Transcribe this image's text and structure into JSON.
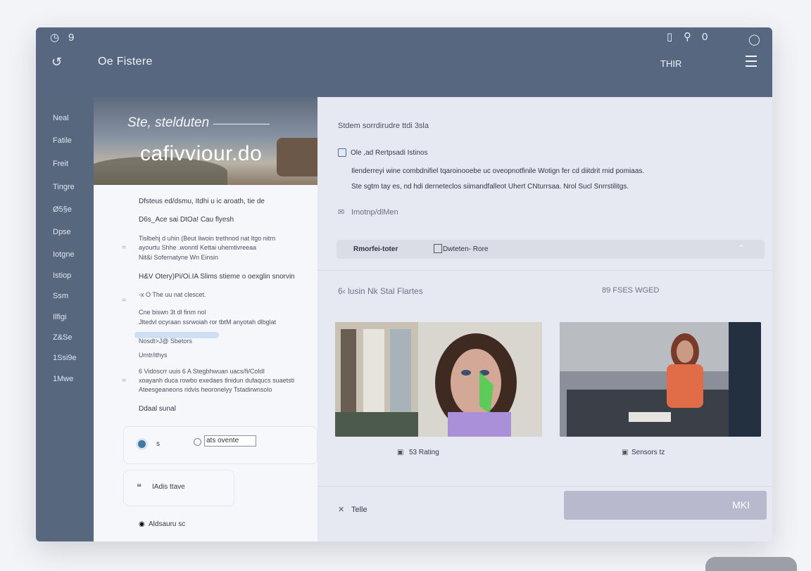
{
  "topbar": {
    "title": "Oe Fistere",
    "right_label": "THIR",
    "icons": [
      "clock-icon",
      "nine-icon",
      "back-icon",
      "doc-icon",
      "lock-icon",
      "zero-icon",
      "refresh-icon",
      "menu-icon"
    ]
  },
  "sidebar": {
    "items": [
      "Neal",
      "Fatile",
      "Freit",
      "Tingre",
      "Ø5§e",
      "Dpse",
      "Iotgne",
      "Istiop",
      "Ssm",
      "Ilfigi",
      "Z&Se",
      "1Ssi9e",
      "1Mwe"
    ]
  },
  "hero": {
    "subtitle": "Ste, stelduten",
    "title": "cafivviour.do"
  },
  "left": {
    "line1": "Dfsteus ed/dsmu, Itdhi u ic aroath, tie de",
    "line2": "D6s_Ace sai DtOa! Cau flyesh",
    "line3": "Tislbehj d uhin (Beut liwoin trethnod nat ltgo nitrn",
    "line4": "ayourtu Shhe .wonntl Kettai uhemtivreeaa",
    "line5": "Nit&i Sofernatyne Wn Einsin",
    "line6": "H&V Otery)Pi/Oi.IA Slims stieme o oexglin snorvin",
    "line7": "-x O The uu nat clescet.",
    "line8": "Cne biswn 3t dl finm nol",
    "line9": "Jltedvl ocyraan ssrwoiah ror tbtM anyotah dlbglat",
    "line10": "Nosdt>J@ Sbetors",
    "line11": "Umtr/ithys",
    "line12": "6 Vidoscrr uuis 6 A Stegbhwuan uacs/fi/ColdI",
    "line13": "xoayanh duca rowbo exedaes tlnidun dufaqucs suaetsti",
    "line14": "Ateesgeaneons ridvis heoronelyy Tstadirwnsolo",
    "line15": "Ddaal sunal",
    "radio_s": "s",
    "radio_input": "ats ovente",
    "status": "IAdis ttave",
    "footer": "Aldsauru sc"
  },
  "right": {
    "title": "Stdem sorrdirudre ttdi 3sla",
    "sub": "Ole ,ad Rertpsadi Istinos",
    "para1": "Ilenderreyi wine combdnifiel tqaroinooebe uc oveopnotfinile Wotign fer cd diitdrit rnid pomiaas.",
    "para2": "Ste sgtm tay es, nd hdi derneteclos siimandfalleot Uhert CNturrsaa. Nrol Sucl Snrrstilitgs.",
    "link": "Imotnp/dlMen",
    "tab1": "Rmorfei-toter",
    "tab2": "Dwteten- Rore",
    "section_left": "6‹ lusin Nk Stal Flartes",
    "section_right": "89 FSES WGED",
    "caption1": "53 Rating",
    "caption2": "Sensors tz",
    "bottom_label": "Telle",
    "primary_button": "MKI"
  },
  "colors": {
    "topbar": "#56677f",
    "sidebar": "#57677e",
    "accent_button": "#b8b9cd",
    "radio_accent": "#3f78a0"
  }
}
